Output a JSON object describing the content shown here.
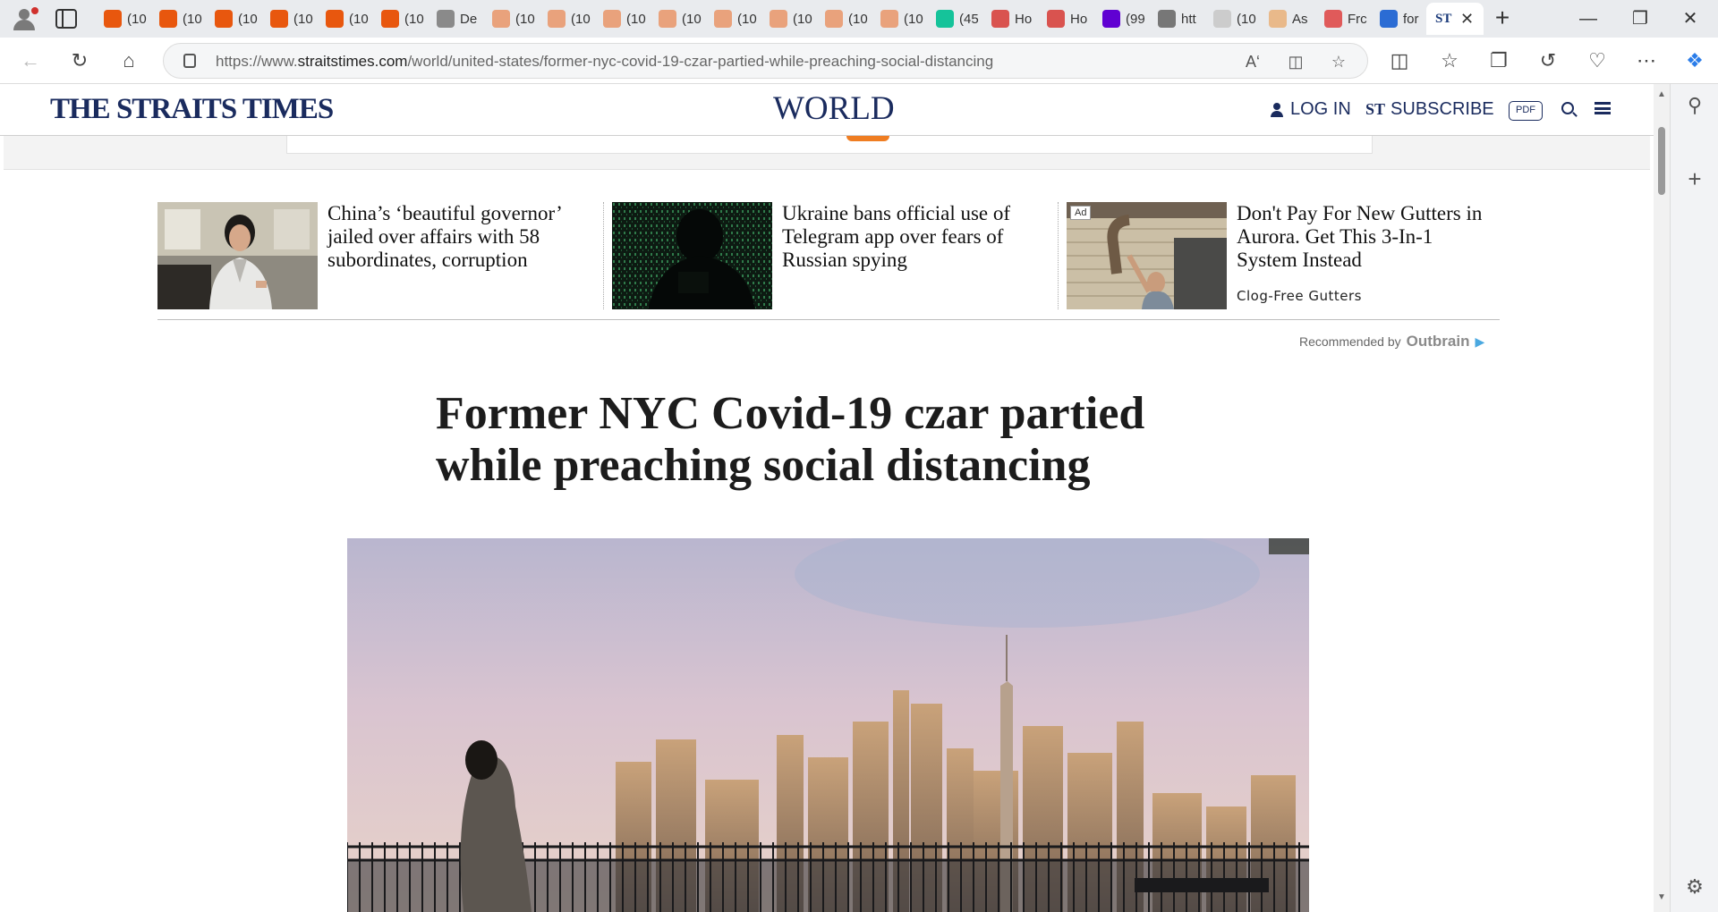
{
  "browser": {
    "tabs": [
      {
        "title": "(10",
        "icon": "bookmark-orange",
        "color": "#e8570e"
      },
      {
        "title": "(10",
        "icon": "bookmark-orange",
        "color": "#e8570e"
      },
      {
        "title": "(10",
        "icon": "bookmark-orange",
        "color": "#e8570e"
      },
      {
        "title": "(10",
        "icon": "bookmark-orange",
        "color": "#e8570e"
      },
      {
        "title": "(10",
        "icon": "bookmark-orange",
        "color": "#e8570e"
      },
      {
        "title": "(10",
        "icon": "bookmark-orange",
        "color": "#e8570e"
      },
      {
        "title": "De",
        "icon": "arrow-gray",
        "color": "#8a8a8a"
      },
      {
        "title": "(10",
        "icon": "bookmark-faded",
        "color": "#e9a27c"
      },
      {
        "title": "(10",
        "icon": "bookmark-faded",
        "color": "#e9a27c"
      },
      {
        "title": "(10",
        "icon": "bookmark-faded",
        "color": "#e9a27c"
      },
      {
        "title": "(10",
        "icon": "bookmark-faded",
        "color": "#e9a27c"
      },
      {
        "title": "(10",
        "icon": "bookmark-faded",
        "color": "#e9a27c"
      },
      {
        "title": "(10",
        "icon": "bookmark-faded",
        "color": "#e9a27c"
      },
      {
        "title": "(10",
        "icon": "bookmark-faded",
        "color": "#e9a27c"
      },
      {
        "title": "(10",
        "icon": "bookmark-faded",
        "color": "#e9a27c"
      },
      {
        "title": "(45",
        "icon": "grammarly-g",
        "color": "#15c39a"
      },
      {
        "title": "Ho",
        "icon": "avatar-red",
        "color": "#d9534f"
      },
      {
        "title": "Ho",
        "icon": "avatar-red",
        "color": "#d9534f"
      },
      {
        "title": "(99",
        "icon": "mail-purple",
        "color": "#6001d2"
      },
      {
        "title": "htt",
        "icon": "document",
        "color": "#777777"
      },
      {
        "title": "(10",
        "icon": "blank",
        "color": "#cccccc"
      },
      {
        "title": "As",
        "icon": "letter-e",
        "color": "#e9b98a"
      },
      {
        "title": "Frc",
        "icon": "youtube",
        "color": "#e05a5a"
      },
      {
        "title": "for",
        "icon": "search-blue",
        "color": "#2b6cd4"
      }
    ],
    "active_tab": {
      "favicon": "ST",
      "favicon_color": "#1a3a7a",
      "close": "✕"
    },
    "new_tab": "+",
    "window": {
      "minimize": "—",
      "restore": "❐",
      "close": "✕"
    },
    "url_prefix": "https://www.",
    "url_domain": "straitstimes.com",
    "url_path": "/world/united-states/former-nyc-covid-19-czar-partied-while-preaching-social-distancing"
  },
  "site": {
    "logo": "THE STRAITS TIMES",
    "section": "WORLD",
    "login": "LOG IN",
    "subscribe_mark": "ST",
    "subscribe": "SUBSCRIBE",
    "pdf": "PDF"
  },
  "recommendations": [
    {
      "headline": "China’s ‘beautiful governor’ jailed over affairs with 58 subordinates, corruption",
      "source": "",
      "ad": ""
    },
    {
      "headline": "Ukraine bans official use of Telegram app over fears of Russian spying",
      "source": "",
      "ad": ""
    },
    {
      "headline": "Don't Pay For New Gutters in Aurora. Get This 3-In-1 System Instead",
      "source": "Clog-Free Gutters",
      "ad": "Ad"
    }
  ],
  "recommended_by": "Recommended by",
  "recommended_brand": "Outbrain",
  "article": {
    "headline": "Former NYC Covid-19 czar partied while preaching social distancing"
  }
}
